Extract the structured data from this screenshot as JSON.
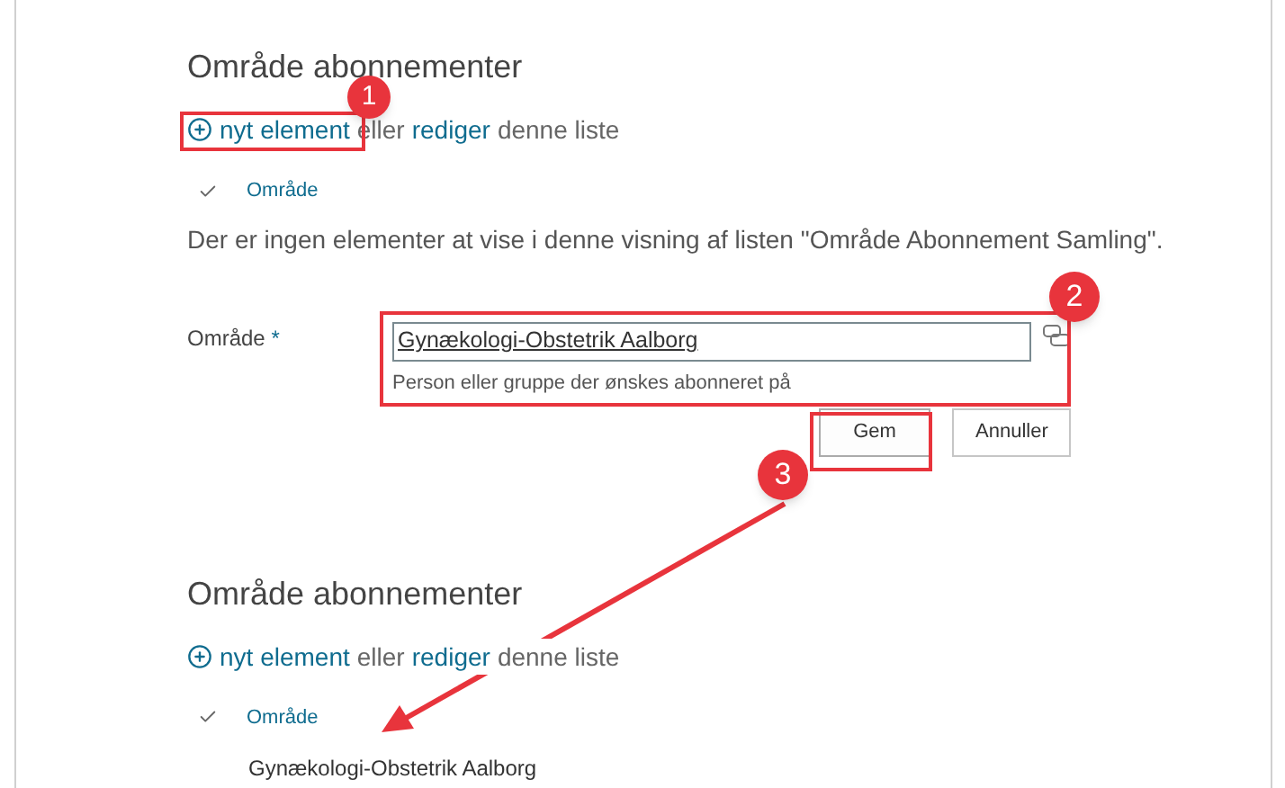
{
  "sections": [
    {
      "title": "Område abonnementer",
      "new_item_link": "nyt element",
      "or_text": "eller",
      "edit_link": "rediger",
      "rest_text": "denne liste",
      "column_header": "Område",
      "empty_message": "Der er ingen elementer at vise i denne visning af listen \"Område Abonnement Samling\"."
    },
    {
      "title": "Område abonnementer",
      "new_item_link": "nyt element",
      "or_text": "eller",
      "edit_link": "rediger",
      "rest_text": "denne liste",
      "column_header": "Område",
      "rows": [
        "Gynækologi-Obstetrik Aalborg"
      ]
    }
  ],
  "form": {
    "label": "Område",
    "required_mark": "*",
    "value": "Gynækologi-Obstetrik Aalborg",
    "hint": "Person eller gruppe der ønskes abonneret på"
  },
  "buttons": [
    {
      "label": "Gem",
      "kind": "primary"
    },
    {
      "label": "Annuller",
      "kind": "secondary"
    }
  ],
  "callouts": [
    {
      "number": "1"
    },
    {
      "number": "2"
    },
    {
      "number": "3"
    }
  ]
}
